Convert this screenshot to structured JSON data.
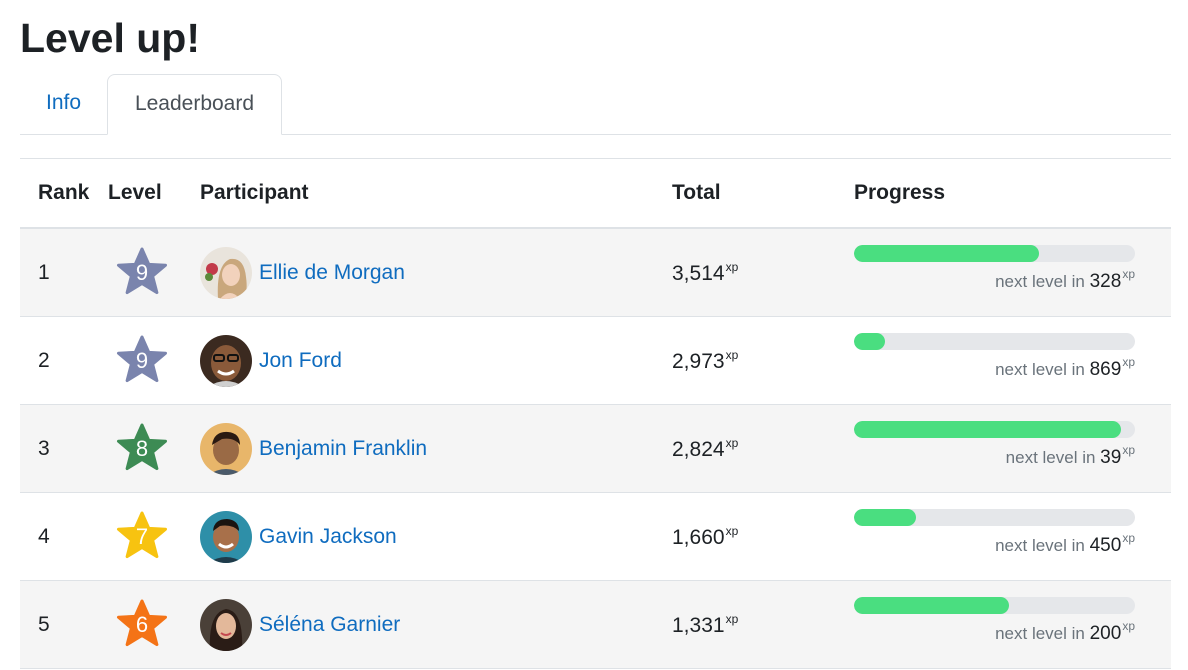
{
  "page": {
    "title": "Level up!"
  },
  "tabs": [
    {
      "label": "Info",
      "active": false
    },
    {
      "label": "Leaderboard",
      "active": true
    }
  ],
  "table": {
    "headers": {
      "rank": "Rank",
      "level": "Level",
      "participant": "Participant",
      "total": "Total",
      "progress": "Progress"
    },
    "xp_unit": "xp",
    "next_level_text": "next level in",
    "rows": [
      {
        "rank": "1",
        "level": "9",
        "level_color": "#7a84ad",
        "name": "Ellie de Morgan",
        "total": "3,514",
        "progress": 0.66,
        "next_level": "328"
      },
      {
        "rank": "2",
        "level": "9",
        "level_color": "#7a84ad",
        "name": "Jon Ford",
        "total": "2,973",
        "progress": 0.11,
        "next_level": "869"
      },
      {
        "rank": "3",
        "level": "8",
        "level_color": "#3d8b54",
        "name": "Benjamin Franklin",
        "total": "2,824",
        "progress": 0.95,
        "next_level": "39"
      },
      {
        "rank": "4",
        "level": "7",
        "level_color": "#f7c310",
        "name": "Gavin Jackson",
        "total": "1,660",
        "progress": 0.22,
        "next_level": "450"
      },
      {
        "rank": "5",
        "level": "6",
        "level_color": "#f47316",
        "name": "Séléna Garnier",
        "total": "1,331",
        "progress": 0.55,
        "next_level": "200"
      }
    ]
  },
  "colors": {
    "link": "#0f6cbf",
    "progress_fill": "#4ade80",
    "progress_track": "#e5e7ea"
  }
}
